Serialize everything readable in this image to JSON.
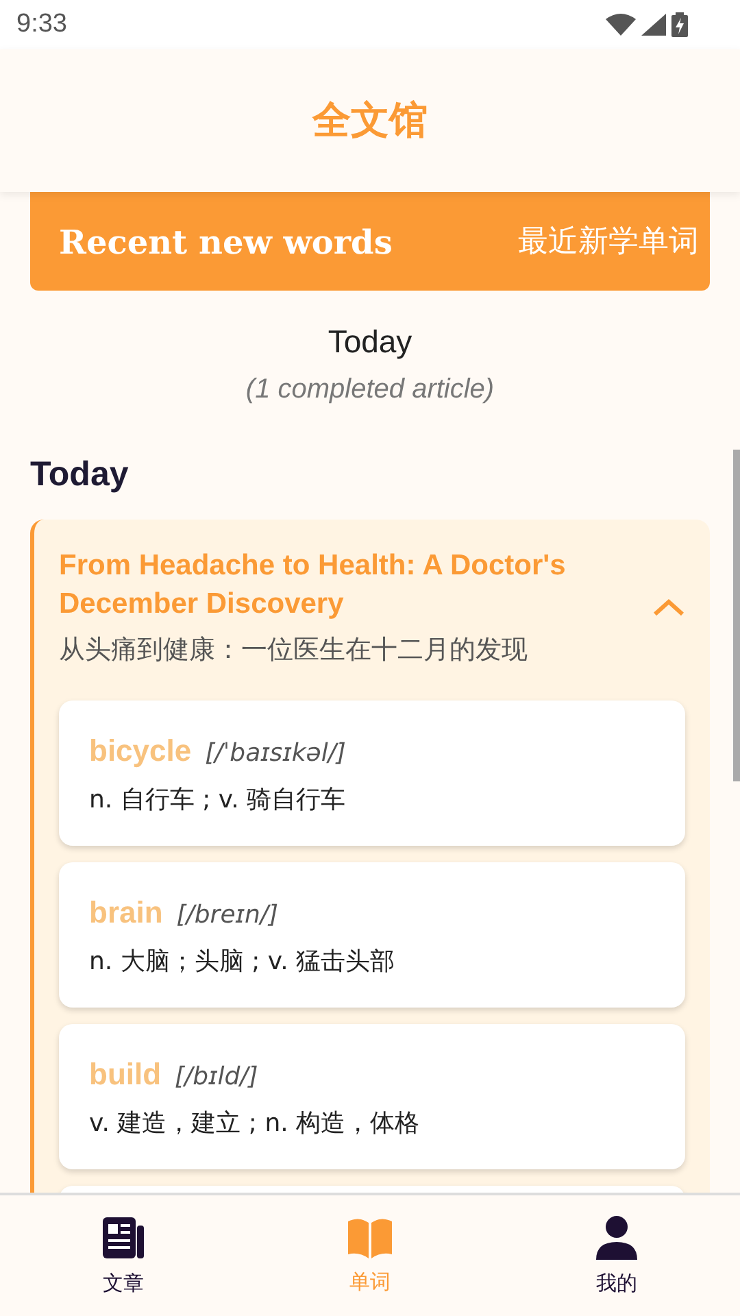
{
  "status_bar": {
    "time": "9:33"
  },
  "header": {
    "title": "全文馆"
  },
  "banner": {
    "title": "Recent new words",
    "subtitle": "最近新学单词"
  },
  "summary": {
    "day": "Today",
    "count": "(1 completed article)"
  },
  "section_title": "Today",
  "article": {
    "title": "From Headache to Health: A Doctor's December Discovery",
    "translation": "从头痛到健康：一位医生在十二月的发现",
    "expanded": true,
    "words": [
      {
        "word": "bicycle",
        "phonetic": "[/ˈbaɪsɪkəl/]",
        "meaning": "n. 自行车 ; v. 骑自行车"
      },
      {
        "word": "brain",
        "phonetic": "[/breɪn/]",
        "meaning": "n. 大脑；头脑 ; v. 猛击头部"
      },
      {
        "word": "build",
        "phonetic": "[/bɪld/]",
        "meaning": "v. 建造，建立 ; n. 构造，体格"
      }
    ]
  },
  "bottom_nav": [
    {
      "label": "文章",
      "kind": "article",
      "selected": false
    },
    {
      "label": "单词",
      "kind": "book",
      "selected": true
    },
    {
      "label": "我的",
      "kind": "person",
      "selected": false
    }
  ]
}
